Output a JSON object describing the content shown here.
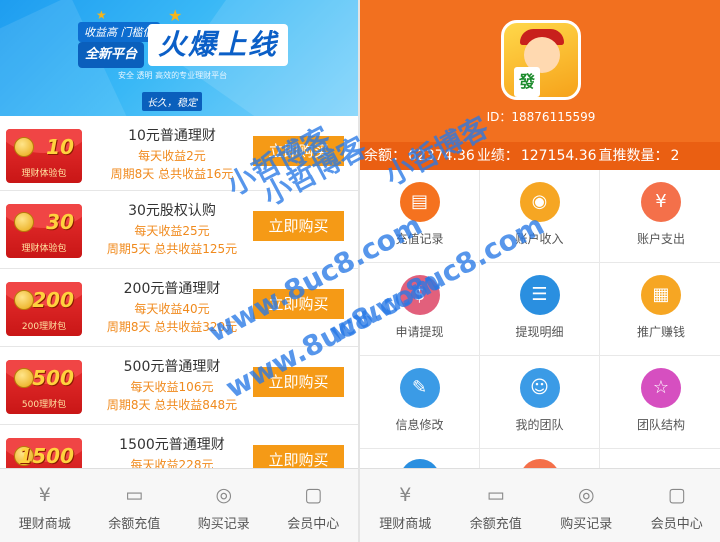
{
  "left": {
    "banner": {
      "badge": "收益高 门槛低",
      "tag": "全新平台",
      "headline": "火爆上线",
      "subtitle": "安全  透明  高效的专业理财平台",
      "slogan": "长久，稳定"
    },
    "products": [
      {
        "envelope_amount": "10",
        "envelope_caption": "理财体验包",
        "title": "10元普通理财",
        "daily": "每天收益2元",
        "period": "周期8天 总共收益16元",
        "buy_label": "立即购买"
      },
      {
        "envelope_amount": "30",
        "envelope_caption": "理财体验包",
        "title": "30元股权认购",
        "daily": "每天收益25元",
        "period": "周期5天 总共收益125元",
        "buy_label": "立即购买"
      },
      {
        "envelope_amount": "200",
        "envelope_caption": "200理财包",
        "title": "200元普通理财",
        "daily": "每天收益40元",
        "period": "周期8天 总共收益320元",
        "buy_label": "立即购买"
      },
      {
        "envelope_amount": "500",
        "envelope_caption": "500理财包",
        "title": "500元普通理财",
        "daily": "每天收益106元",
        "period": "周期8天 总共收益848元",
        "buy_label": "立即购买"
      },
      {
        "envelope_amount": "1500",
        "envelope_caption": "",
        "title": "1500元普通理财",
        "daily": "每天收益228元",
        "period": "",
        "buy_label": "立即购买"
      }
    ],
    "tabbar": [
      {
        "icon": "money-bag-icon",
        "glyph": "¥",
        "label": "理财商城"
      },
      {
        "icon": "ticket-icon",
        "glyph": "▭",
        "label": "余额充值"
      },
      {
        "icon": "location-icon",
        "glyph": "◎",
        "label": "购买记录"
      },
      {
        "icon": "chat-icon",
        "glyph": "▢",
        "label": "会员中心"
      }
    ]
  },
  "right": {
    "profile": {
      "avatar_tile": "發",
      "user_id": "ID：18876115599",
      "balance_label": "余额：",
      "balance_value": "62374.36",
      "performance_label": "业绩：",
      "performance_value": "127154.36",
      "referrals_label": "直推数量：",
      "referrals_value": "2"
    },
    "menu": [
      {
        "icon": "document-icon",
        "glyph": "▤",
        "color": "#f5721f",
        "label": "充值记录"
      },
      {
        "icon": "wallet-icon",
        "glyph": "◉",
        "color": "#f6a623",
        "label": "账户收入"
      },
      {
        "icon": "money-bag-icon",
        "glyph": "¥",
        "color": "#f4704a",
        "label": "账户支出"
      },
      {
        "icon": "withdraw-icon",
        "glyph": "$",
        "color": "#e2607c",
        "label": "申请提现"
      },
      {
        "icon": "list-icon",
        "glyph": "☰",
        "color": "#2a8fe0",
        "label": "提现明细"
      },
      {
        "icon": "qrcode-icon",
        "glyph": "▦",
        "color": "#f6a623",
        "label": "推广赚钱"
      },
      {
        "icon": "profile-edit-icon",
        "glyph": "✎",
        "color": "#3b9be6",
        "label": "信息修改"
      },
      {
        "icon": "team-icon",
        "glyph": "☺",
        "color": "#3b9be6",
        "label": "我的团队"
      },
      {
        "icon": "star-icon",
        "glyph": "☆",
        "color": "#d64fc0",
        "label": "团队结构"
      }
    ],
    "tabbar": [
      {
        "icon": "money-bag-icon",
        "glyph": "¥",
        "label": "理财商城"
      },
      {
        "icon": "ticket-icon",
        "glyph": "▭",
        "label": "余额充值"
      },
      {
        "icon": "location-icon",
        "glyph": "◎",
        "label": "购买记录"
      },
      {
        "icon": "chat-icon",
        "glyph": "▢",
        "label": "会员中心"
      }
    ]
  },
  "watermark": {
    "blog": "小哲博客",
    "domain": "www.8uc8.com"
  },
  "colors": {
    "accent_orange": "#f2701f",
    "buy_button": "#f59a16",
    "banner_blue": "#1e9df0"
  }
}
